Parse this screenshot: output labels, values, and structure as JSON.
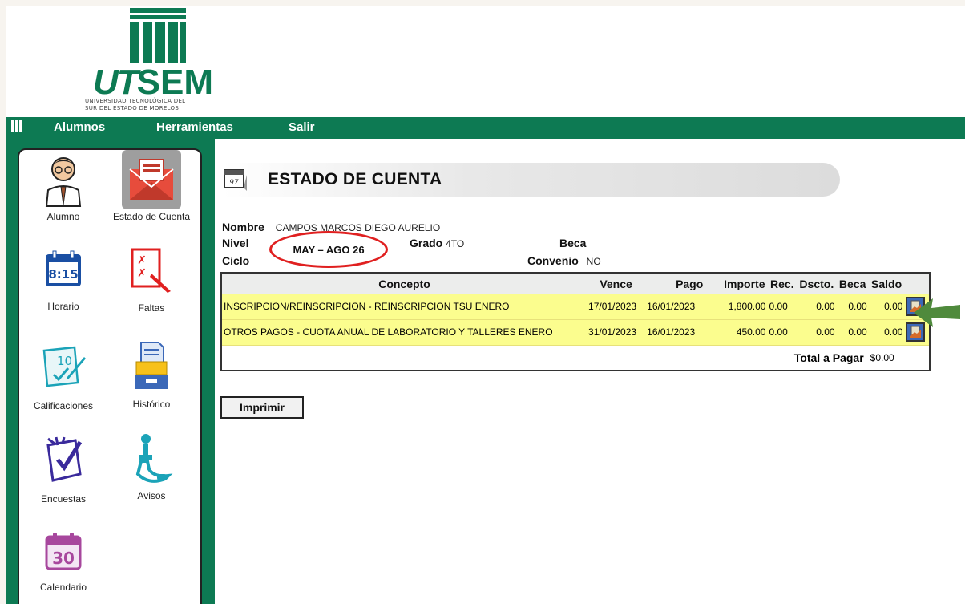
{
  "logo": {
    "brand": "UTSEM",
    "brand_prefix": "UT",
    "brand_suffix": "SEM",
    "line1": "UNIVERSIDAD TECNOLÓGICA DEL",
    "line2": "SUR DEL ESTADO DE MORELOS"
  },
  "menu": {
    "items": [
      "Alumnos",
      "Herramientas",
      "Salir"
    ]
  },
  "sidebar": {
    "items": [
      {
        "label": "Alumno",
        "icon": "student-icon"
      },
      {
        "label": "Estado de Cuenta",
        "icon": "envelope-icon"
      },
      {
        "label": "Horario",
        "icon": "clock-calendar-icon"
      },
      {
        "label": "Faltas",
        "icon": "absences-icon"
      },
      {
        "label": "Calificaciones",
        "icon": "grades-icon"
      },
      {
        "label": "Histórico",
        "icon": "archive-icon"
      },
      {
        "label": "Encuestas",
        "icon": "survey-icon"
      },
      {
        "label": "Avisos",
        "icon": "notices-icon"
      },
      {
        "label": "Calendario",
        "icon": "calendar-icon"
      }
    ],
    "calendar_day": "30",
    "clock_text": "8:15"
  },
  "page": {
    "title": "ESTADO DE CUENTA",
    "calendar_icon_text": "97"
  },
  "info": {
    "nombre_label": "Nombre",
    "nombre": "CAMPOS MARCOS DIEGO AURELIO",
    "nivel_label": "Nivel",
    "grado_label": "Grado",
    "grado": "4TO",
    "beca_label": "Beca",
    "ciclo_label": "Ciclo",
    "ciclo": "MAY – AGO 26",
    "convenio_label": "Convenio",
    "convenio": "NO"
  },
  "table": {
    "headers": [
      "Concepto",
      "Vence",
      "Pago",
      "Importe",
      "Rec.",
      "Dscto.",
      "Beca",
      "Saldo"
    ],
    "rows": [
      {
        "concepto": "INSCRIPCION/REINSCRIPCION - REINSCRIPCION TSU ENERO",
        "vence": "17/01/2023",
        "pago": "16/01/2023",
        "importe": "1,800.00",
        "rec": "0.00",
        "dscto": "0.00",
        "beca": "0.00",
        "saldo": "0.00"
      },
      {
        "concepto": "OTROS PAGOS - CUOTA ANUAL DE LABORATORIO Y TALLERES ENERO",
        "vence": "31/01/2023",
        "pago": "16/01/2023",
        "importe": "450.00",
        "rec": "0.00",
        "dscto": "0.00",
        "beca": "0.00",
        "saldo": "0.00"
      }
    ],
    "total_label": "Total a Pagar",
    "total_value": "$0.00"
  },
  "buttons": {
    "print": "Imprimir"
  },
  "colors": {
    "brand_green": "#0d7a53",
    "row_yellow": "#fbfd8e",
    "annotation_red": "#e02020",
    "arrow_green": "#4f8a3c"
  }
}
